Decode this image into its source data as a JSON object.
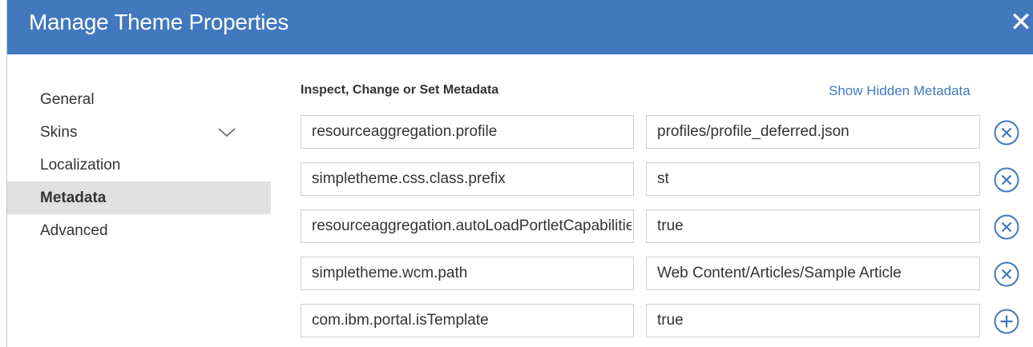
{
  "dialog": {
    "title": "Manage Theme Properties",
    "close_symbol": "✕"
  },
  "nav": {
    "items": [
      {
        "label": "General"
      },
      {
        "label": "Skins",
        "has_chevron": true
      },
      {
        "label": "Localization"
      },
      {
        "label": "Metadata",
        "active": true
      },
      {
        "label": "Advanced"
      }
    ]
  },
  "metadata": {
    "section_label": "Inspect, Change or Set Metadata",
    "show_hidden_label": "Show Hidden Metadata",
    "rows": [
      {
        "key": "resourceaggregation.profile",
        "value": "profiles/profile_deferred.json",
        "action_icon": "remove-circle-icon"
      },
      {
        "key": "simpletheme.css.class.prefix",
        "value": "st",
        "action_icon": "remove-circle-icon"
      },
      {
        "key": "resourceaggregation.autoLoadPortletCapabilities",
        "value": "true",
        "action_icon": "remove-circle-icon"
      },
      {
        "key": "simpletheme.wcm.path",
        "value": "Web Content/Articles/Sample Article",
        "action_icon": "remove-circle-icon"
      },
      {
        "key": "com.ibm.portal.isTemplate",
        "value": "true",
        "action_icon": "add-circle-icon"
      }
    ]
  },
  "colors": {
    "header": "#4178be",
    "link": "#4178be",
    "active_nav": "#e1e1e1"
  }
}
